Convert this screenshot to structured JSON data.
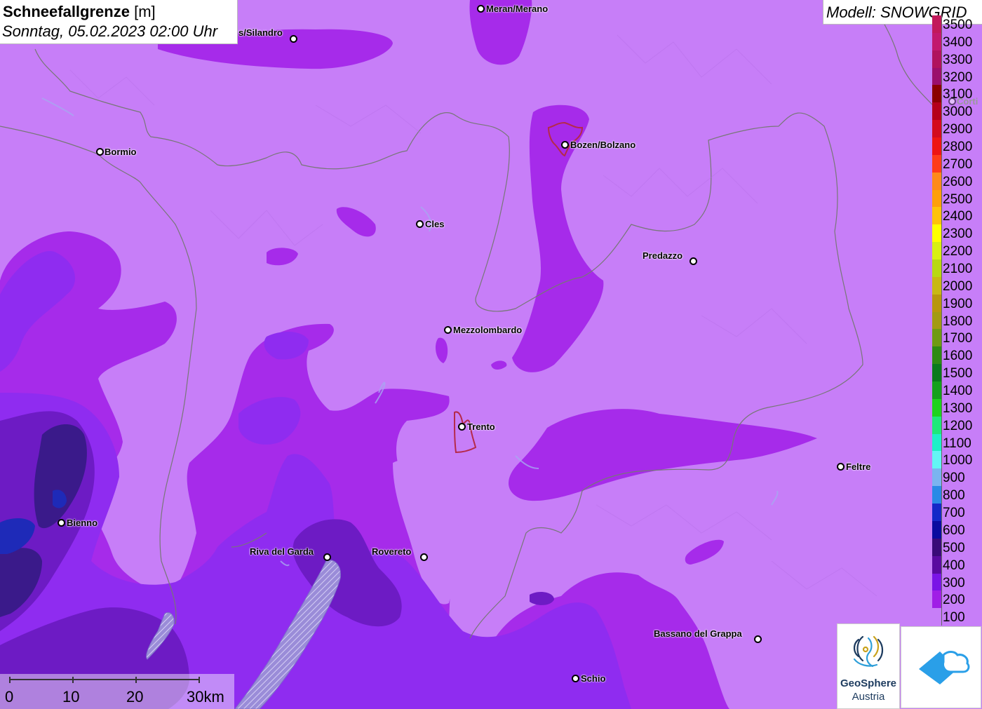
{
  "title": {
    "parameter": "Schneefallgrenze",
    "unit": "[m]",
    "datetime": "Sonntag, 05.02.2023 02:00 Uhr"
  },
  "model": "Modell: SNOWGRID",
  "cities": [
    {
      "name": "Meran/Merano",
      "label_side": "right"
    },
    {
      "name": "s/Silandro",
      "label_side": "left"
    },
    {
      "name": "Bormio",
      "label_side": "right"
    },
    {
      "name": "Bozen/Bolzano",
      "label_side": "right"
    },
    {
      "name": "Cles",
      "label_side": "right"
    },
    {
      "name": "Predazzo",
      "label_side": "left"
    },
    {
      "name": "Mezzolombardo",
      "label_side": "right"
    },
    {
      "name": "Trento",
      "label_side": "right"
    },
    {
      "name": "Feltre",
      "label_side": "right"
    },
    {
      "name": "Bienno",
      "label_side": "right"
    },
    {
      "name": "Riva del Garda",
      "label_side": "left"
    },
    {
      "name": "Rovereto",
      "label_side": "left"
    },
    {
      "name": "Bassano del Grappa",
      "label_side": "left"
    },
    {
      "name": "Schio",
      "label_side": "right"
    },
    {
      "name": "Corti",
      "label_side": "right"
    }
  ],
  "legend": [
    {
      "label": "3500",
      "color": "#c2185b"
    },
    {
      "label": "3400",
      "color": "#c2186e"
    },
    {
      "label": "3300",
      "color": "#b0125e"
    },
    {
      "label": "3200",
      "color": "#9b0e6c"
    },
    {
      "label": "3100",
      "color": "#8b0000"
    },
    {
      "label": "3000",
      "color": "#b5001a"
    },
    {
      "label": "2900",
      "color": "#d40a1e"
    },
    {
      "label": "2800",
      "color": "#ee1414"
    },
    {
      "label": "2700",
      "color": "#ff3b1a"
    },
    {
      "label": "2600",
      "color": "#ff8a1a"
    },
    {
      "label": "2500",
      "color": "#ff9f0a"
    },
    {
      "label": "2400",
      "color": "#ffc20a"
    },
    {
      "label": "2300",
      "color": "#ffff00"
    },
    {
      "label": "2200",
      "color": "#d8f014"
    },
    {
      "label": "2100",
      "color": "#b8d814"
    },
    {
      "label": "2000",
      "color": "#c8b814"
    },
    {
      "label": "1900",
      "color": "#b8960e"
    },
    {
      "label": "1800",
      "color": "#a39a14"
    },
    {
      "label": "1700",
      "color": "#6f9a14"
    },
    {
      "label": "1600",
      "color": "#2e8a14"
    },
    {
      "label": "1500",
      "color": "#0a7a1e"
    },
    {
      "label": "1400",
      "color": "#14a01e"
    },
    {
      "label": "1300",
      "color": "#1ed21e"
    },
    {
      "label": "1200",
      "color": "#1ee87a"
    },
    {
      "label": "1100",
      "color": "#1ef0c8"
    },
    {
      "label": "1000",
      "color": "#64f5f5"
    },
    {
      "label": "900",
      "color": "#7ab4f0"
    },
    {
      "label": "800",
      "color": "#2a8ae6"
    },
    {
      "label": "700",
      "color": "#1428c8"
    },
    {
      "label": "600",
      "color": "#0a0aa0"
    },
    {
      "label": "500",
      "color": "#3a0a78"
    },
    {
      "label": "400",
      "color": "#5a0aa0"
    },
    {
      "label": "300",
      "color": "#7a14e6"
    },
    {
      "label": "200",
      "color": "#a01ee6"
    },
    {
      "label": "100",
      "color": "#c77ef8"
    }
  ],
  "scalebar": {
    "ticks": [
      "0",
      "10",
      "20",
      "30km"
    ]
  },
  "logos": {
    "geosphere_name": "GeoSphere",
    "geosphere_sub": "Austria"
  }
}
